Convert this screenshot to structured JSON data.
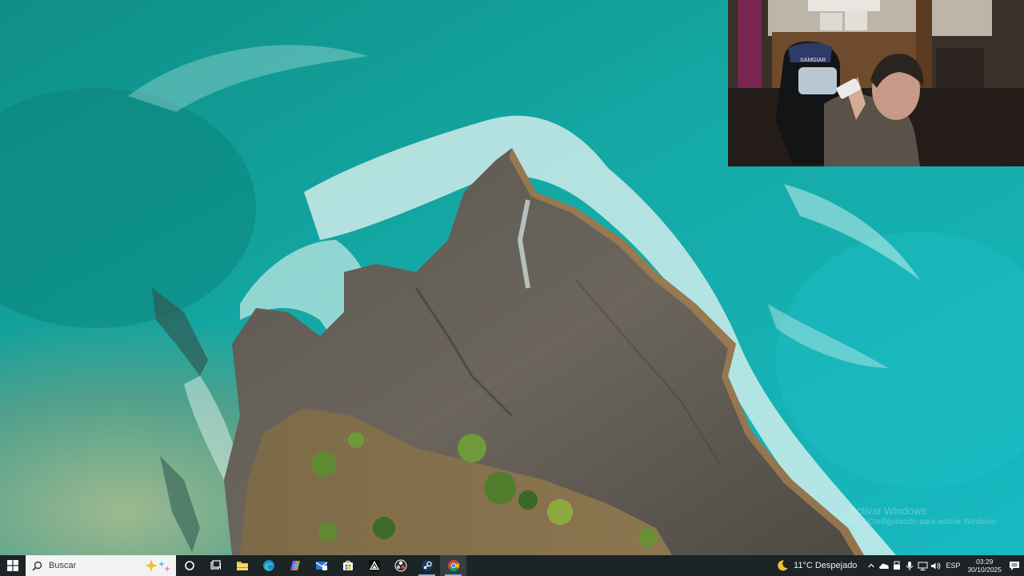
{
  "desktop": {
    "wallpaper_icon": "aerial-coast-wallpaper",
    "watermark": {
      "line1": "Activar Windows",
      "line2": "Ve a Configuración para activar Windows."
    }
  },
  "webcam": {
    "icon": "webcam-feed",
    "chair_brand": "XAMGIAR"
  },
  "taskbar": {
    "start_icon": "windows-logo-icon",
    "search": {
      "placeholder": "Buscar",
      "icon": "search-icon",
      "highlight_icon": "sparkle-icon"
    },
    "pinned": [
      {
        "name": "cortana-button",
        "icon": "circle-icon"
      },
      {
        "name": "task-view-button",
        "icon": "task-view-icon"
      },
      {
        "name": "file-explorer-button",
        "icon": "folder-icon"
      },
      {
        "name": "edge-button",
        "icon": "edge-icon"
      },
      {
        "name": "copilot-button",
        "icon": "copilot-icon"
      },
      {
        "name": "mail-button",
        "icon": "mail-icon"
      },
      {
        "name": "store-button",
        "icon": "store-icon"
      },
      {
        "name": "app-triangle-button",
        "icon": "triangle-app-icon"
      },
      {
        "name": "obs-button",
        "icon": "obs-icon"
      },
      {
        "name": "steam-button",
        "icon": "steam-icon"
      },
      {
        "name": "chrome-button",
        "icon": "chrome-icon"
      }
    ],
    "weather": {
      "icon": "moon-icon",
      "text": "11°C  Despejado"
    },
    "tray_icons": [
      "chevron-up-icon",
      "onedrive-icon",
      "usb-icon",
      "microphone-icon",
      "network-icon",
      "volume-icon"
    ],
    "language": "ESP",
    "clock": {
      "time": "03:29",
      "date": "30/10/2025"
    },
    "notification_icon": "notification-icon",
    "colors": {
      "taskbar_bg": "#1c2426",
      "search_bg": "#f3f3f3",
      "accent_underline": "#7fb4e6"
    }
  }
}
